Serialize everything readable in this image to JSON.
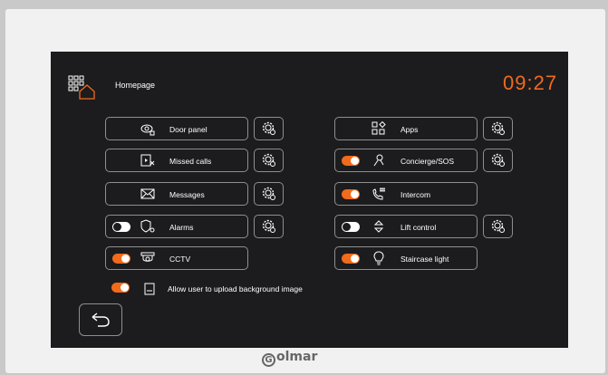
{
  "header": {
    "title": "Homepage",
    "time": "09:27"
  },
  "left_column": [
    {
      "label": "Door panel",
      "icon": "door-panel-icon",
      "toggle": null,
      "settings": true
    },
    {
      "label": "Missed calls",
      "icon": "missed-calls-icon",
      "toggle": null,
      "settings": true
    },
    {
      "label": "Messages",
      "icon": "envelope-icon",
      "toggle": null,
      "settings": true
    },
    {
      "label": "Alarms",
      "icon": "alarm-shield-icon",
      "toggle": "off",
      "settings": true
    },
    {
      "label": "CCTV",
      "icon": "cctv-camera-icon",
      "toggle": "on",
      "settings": false
    }
  ],
  "right_column": [
    {
      "label": "Apps",
      "icon": "apps-grid-icon",
      "toggle": null,
      "settings": true
    },
    {
      "label": "Concierge/SOS",
      "icon": "concierge-icon",
      "toggle": "on",
      "settings": true
    },
    {
      "label": "Intercom",
      "icon": "intercom-phone-icon",
      "toggle": "on",
      "settings": false
    },
    {
      "label": "Lift control",
      "icon": "lift-arrows-icon",
      "toggle": "off",
      "settings": true
    },
    {
      "label": "Staircase light",
      "icon": "lightbulb-icon",
      "toggle": "on",
      "settings": false
    }
  ],
  "upload_option": {
    "label": "Allow user to upload background image",
    "toggle": "on"
  },
  "brand": {
    "logo_text": "olmar",
    "logo_letter": "G"
  },
  "colors": {
    "accent": "#f26a1b",
    "screen_bg": "#1c1c1e",
    "border": "#8e8e8e"
  }
}
